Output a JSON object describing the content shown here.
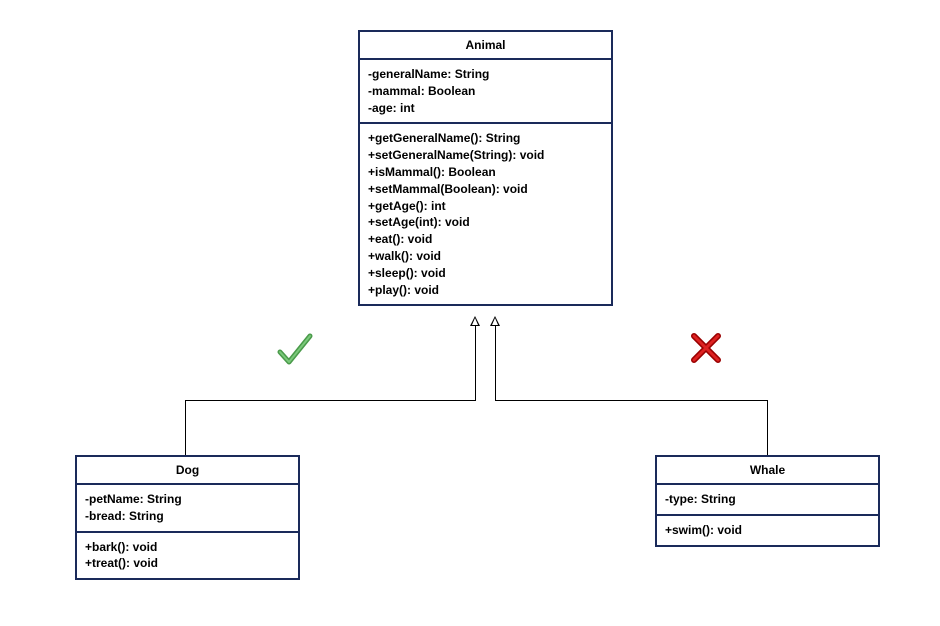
{
  "classes": {
    "animal": {
      "title": "Animal",
      "attributes": [
        "-generalName: String",
        "-mammal: Boolean",
        "-age: int"
      ],
      "methods": [
        "+getGeneralName(): String",
        "+setGeneralName(String): void",
        "+isMammal(): Boolean",
        "+setMammal(Boolean): void",
        "+getAge(): int",
        "+setAge(int): void",
        "+eat(): void",
        "+walk(): void",
        "+sleep(): void",
        "+play(): void"
      ]
    },
    "dog": {
      "title": "Dog",
      "attributes": [
        "-petName: String",
        "-bread: String"
      ],
      "methods": [
        "+bark(): void",
        "+treat(): void"
      ]
    },
    "whale": {
      "title": "Whale",
      "attributes": [
        "-type: String"
      ],
      "methods": [
        "+swim(): void"
      ]
    }
  },
  "markers": {
    "check": "✓",
    "cross": "✗"
  }
}
